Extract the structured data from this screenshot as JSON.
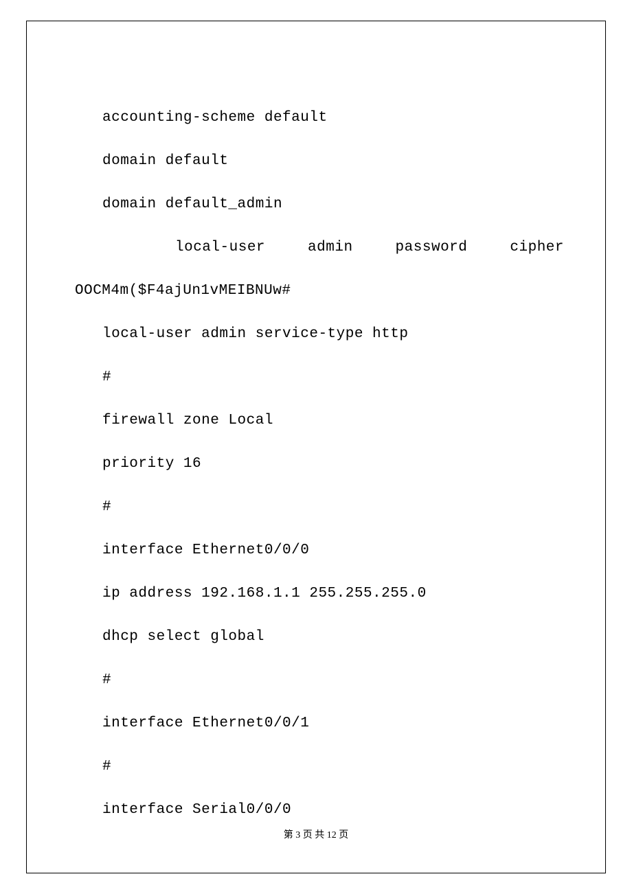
{
  "document": {
    "lines": [
      "accounting-scheme default",
      "domain default",
      "domain default_admin"
    ],
    "justified_line": "local-user    admin    password    cipher",
    "continuation_line": "OOCM4m($F4ajUn1vMEIBNUw#",
    "lines_after": [
      "local-user admin service-type http",
      "#",
      "firewall zone Local",
      "priority 16",
      "#",
      "interface Ethernet0/0/0",
      "ip address 192.168.1.1 255.255.255.0",
      "dhcp select global",
      "#",
      "interface Ethernet0/0/1",
      "#",
      "interface Serial0/0/0"
    ]
  },
  "footer": {
    "text": "第 3 页   共 12 页"
  },
  "page_info": {
    "current_page": 3,
    "total_pages": 12
  }
}
